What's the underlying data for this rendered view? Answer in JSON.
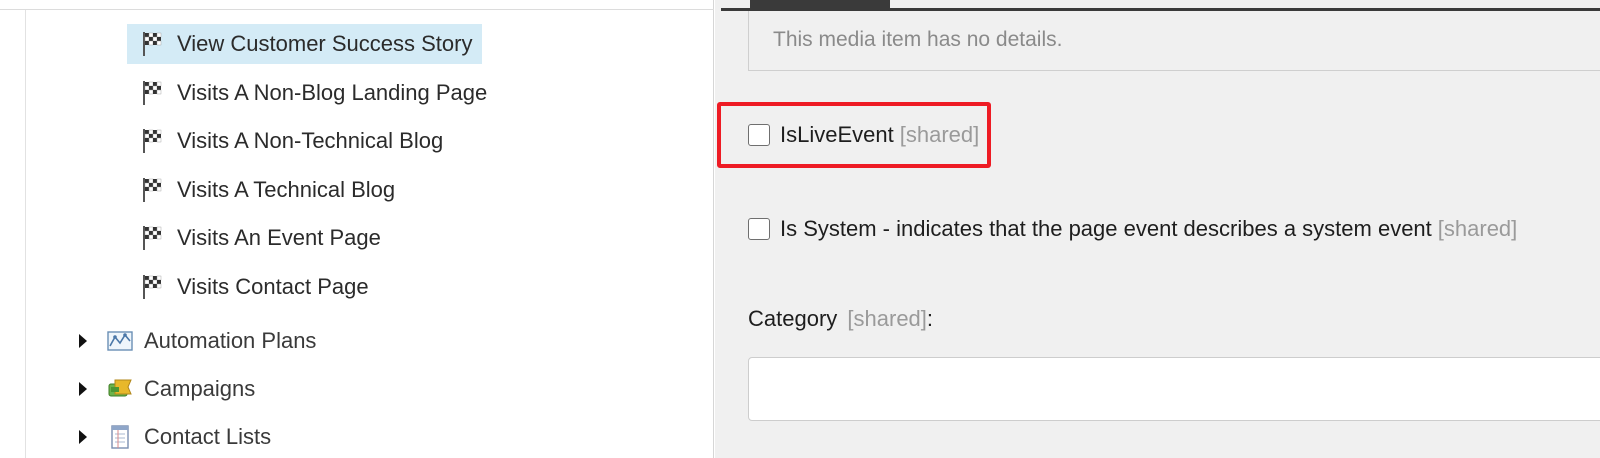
{
  "tree": {
    "goals": [
      {
        "label": "View Customer Success Story",
        "selected": true
      },
      {
        "label": "Visits A Non-Blog Landing Page",
        "selected": false
      },
      {
        "label": "Visits A Non-Technical Blog",
        "selected": false
      },
      {
        "label": "Visits A Technical Blog",
        "selected": false
      },
      {
        "label": "Visits An Event Page",
        "selected": false
      },
      {
        "label": "Visits Contact Page",
        "selected": false
      }
    ],
    "folders": [
      {
        "label": "Automation Plans",
        "icon": "automation-plan-icon"
      },
      {
        "label": "Campaigns",
        "icon": "campaigns-icon"
      },
      {
        "label": "Contact Lists",
        "icon": "contact-list-icon"
      }
    ],
    "goal_icon": "checkered-flag-icon"
  },
  "details": {
    "media_message": "This media item has no details.",
    "is_live_event": {
      "label": "IsLiveEvent",
      "shared": "[shared]",
      "checked": false
    },
    "is_system": {
      "label": "Is System - indicates that the page event describes a system event",
      "shared": "[shared]",
      "checked": false
    },
    "category": {
      "label": "Category",
      "shared": "[shared]",
      "colon": ":",
      "value": ""
    }
  },
  "colors": {
    "selection": "#d4ebf6",
    "highlight": "#ee1b24",
    "panel_bg": "#f0f0f0"
  }
}
